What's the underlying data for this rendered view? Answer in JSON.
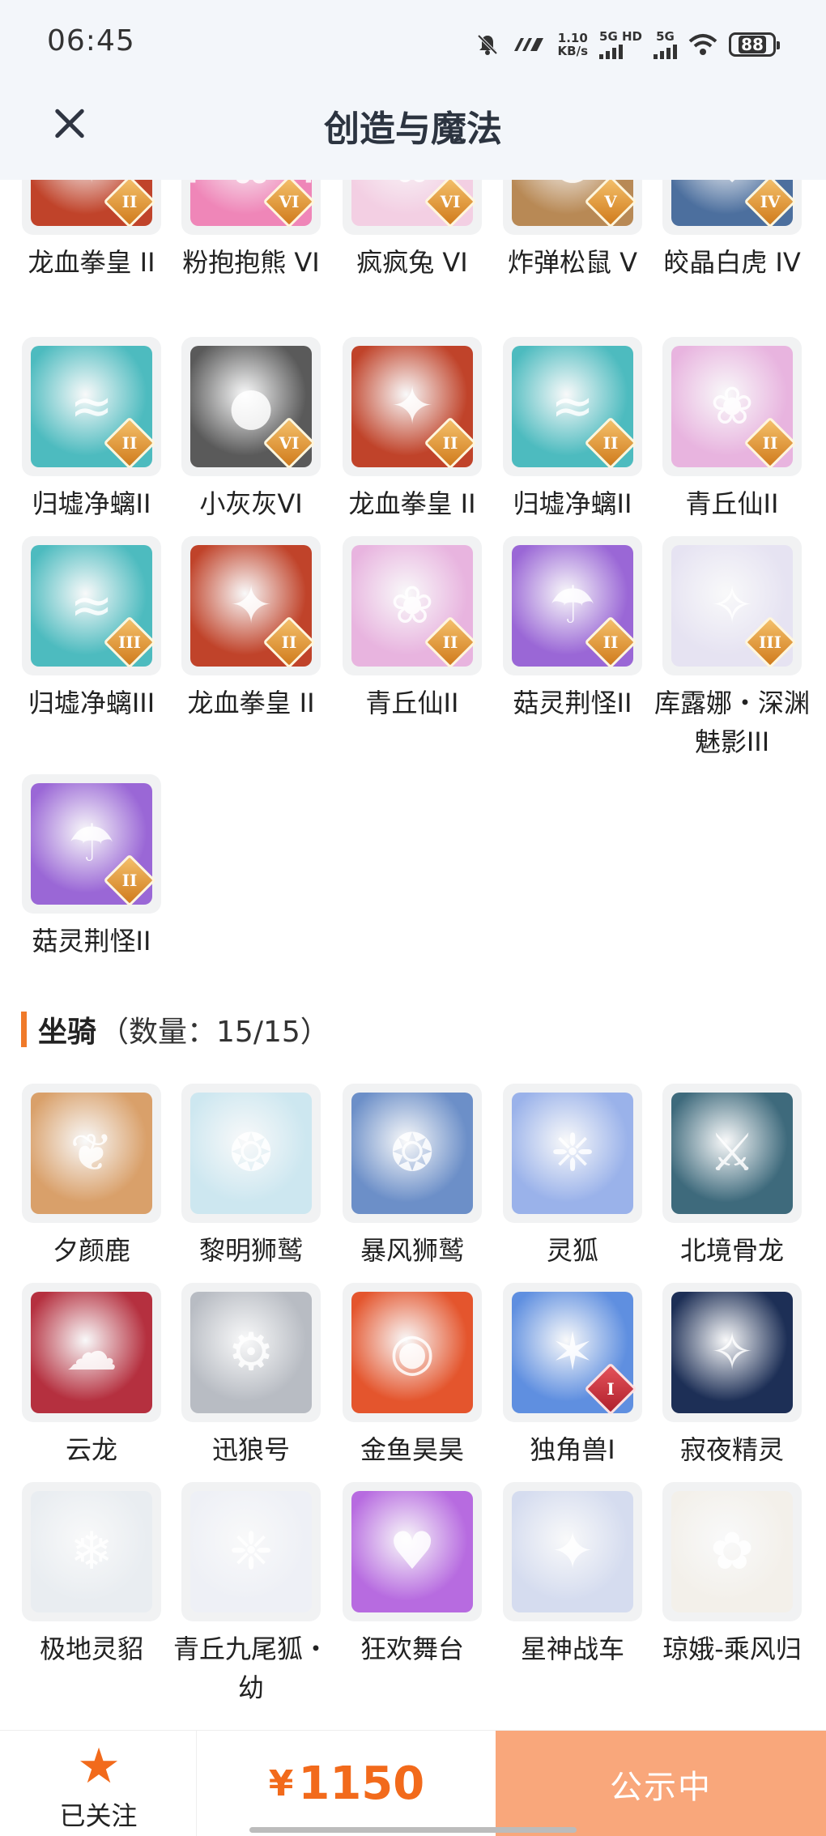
{
  "status_bar": {
    "time": "06:45",
    "speed_value": "1.10",
    "speed_unit": "KB/s",
    "net1": "5G HD",
    "net2": "5G",
    "battery": "88"
  },
  "header": {
    "title": "创造与魔法"
  },
  "rows_top": [
    [
      {
        "name": "龙血拳皇 II",
        "badge": "II",
        "color": "#c0432a",
        "glyph": "✦"
      },
      {
        "name": "粉抱抱熊 VI",
        "badge": "VI",
        "color": "#ef86b8",
        "glyph": "ʕ•ᴥ•ʔ"
      },
      {
        "name": "疯疯兔 VI",
        "badge": "VI",
        "color": "#f3cfe3",
        "glyph": "✿"
      },
      {
        "name": "炸弹松鼠 V",
        "badge": "V",
        "color": "#b88955",
        "glyph": "✪"
      },
      {
        "name": "皎晶白虎 IV",
        "badge": "IV",
        "color": "#4c6f9e",
        "glyph": "❖"
      }
    ],
    [
      {
        "name": "归墟净螭II",
        "badge": "II",
        "color": "#4dbbbf",
        "glyph": "≈"
      },
      {
        "name": "小灰灰VI",
        "badge": "VI",
        "color": "#5a5a5a",
        "glyph": "●"
      },
      {
        "name": "龙血拳皇 II",
        "badge": "II",
        "color": "#c0432a",
        "glyph": "✦"
      },
      {
        "name": "归墟净螭II",
        "badge": "II",
        "color": "#4dbbbf",
        "glyph": "≈"
      },
      {
        "name": "青丘仙II",
        "badge": "II",
        "color": "#e8b4df",
        "glyph": "❀"
      }
    ],
    [
      {
        "name": "归墟净螭III",
        "badge": "III",
        "color": "#4dbbbf",
        "glyph": "≈"
      },
      {
        "name": "龙血拳皇 II",
        "badge": "II",
        "color": "#c0432a",
        "glyph": "✦"
      },
      {
        "name": "青丘仙II",
        "badge": "II",
        "color": "#e8b4df",
        "glyph": "❀"
      },
      {
        "name": "菇灵荆怪II",
        "badge": "II",
        "color": "#9a67d6",
        "glyph": "☂"
      },
      {
        "name": "库露娜・深渊魅影III",
        "badge": "III",
        "color": "#e6e3f2",
        "glyph": "✧"
      }
    ],
    [
      {
        "name": "菇灵荆怪II",
        "badge": "II",
        "color": "#9a67d6",
        "glyph": "☂"
      }
    ]
  ],
  "mounts_section": {
    "title": "坐骑",
    "count": "（数量：15/15）"
  },
  "rows_mounts": [
    [
      {
        "name": "夕颜鹿",
        "badge": "",
        "color": "#d9a06a",
        "glyph": "❦"
      },
      {
        "name": "黎明狮鹫",
        "badge": "",
        "color": "#cde7f0",
        "glyph": "❂"
      },
      {
        "name": "暴风狮鹫",
        "badge": "",
        "color": "#6c8fc8",
        "glyph": "❂"
      },
      {
        "name": "灵狐",
        "badge": "",
        "color": "#9ab2ea",
        "glyph": "❈"
      },
      {
        "name": "北境骨龙",
        "badge": "",
        "color": "#3e6a7c",
        "glyph": "⚔"
      }
    ],
    [
      {
        "name": "云龙",
        "badge": "",
        "color": "#b5303f",
        "glyph": "☁"
      },
      {
        "name": "迅狼号",
        "badge": "",
        "color": "#b8bcc3",
        "glyph": "⚙"
      },
      {
        "name": "金鱼昊昊",
        "badge": "",
        "color": "#e4552d",
        "glyph": "◉"
      },
      {
        "name": "独角兽I",
        "badge": "I",
        "color": "#5f8fe0",
        "glyph": "✶",
        "badge_red": true
      },
      {
        "name": "寂夜精灵",
        "badge": "",
        "color": "#1d2f56",
        "glyph": "✧"
      }
    ],
    [
      {
        "name": "极地灵貂",
        "badge": "",
        "color": "#e9edf1",
        "glyph": "❄"
      },
      {
        "name": "青丘九尾狐・幼",
        "badge": "",
        "color": "#eef0f6",
        "glyph": "❈"
      },
      {
        "name": "狂欢舞台",
        "badge": "",
        "color": "#b76be0",
        "glyph": "♥"
      },
      {
        "name": "星神战车",
        "badge": "",
        "color": "#d5dcef",
        "glyph": "✦"
      },
      {
        "name": "琼娥-乘风归",
        "badge": "",
        "color": "#f3f0ea",
        "glyph": "✿"
      }
    ]
  ],
  "bottom_bar": {
    "follow_label": "已关注",
    "currency": "¥",
    "price": "1150",
    "status_label": "公示中"
  },
  "colors": {
    "accent": "#f26a1b",
    "status_button": "#f9a77b",
    "header_bg": "#f3f6fa"
  },
  "icons": {
    "close": "close-icon",
    "star": "star-icon",
    "wifi": "wifi-icon",
    "mute": "bell-off-icon"
  }
}
